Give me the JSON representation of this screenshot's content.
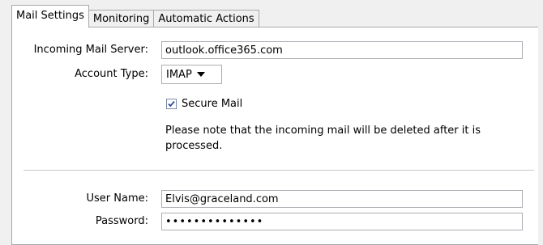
{
  "tabs": [
    {
      "label": "Mail Settings"
    },
    {
      "label": "Monitoring"
    },
    {
      "label": "Automatic Actions"
    }
  ],
  "form": {
    "incoming_server_label": "Incoming Mail Server:",
    "incoming_server_value": "outlook.office365.com",
    "account_type_label": "Account Type:",
    "account_type_value": "IMAP",
    "secure_mail_label": "Secure Mail",
    "secure_mail_checked": true,
    "note_text": "Please note that the incoming mail will be deleted after it is processed.",
    "user_name_label": "User Name:",
    "user_name_value": "Elvis@graceland.com",
    "password_label": "Password:",
    "password_value": "••••••••••••••"
  }
}
